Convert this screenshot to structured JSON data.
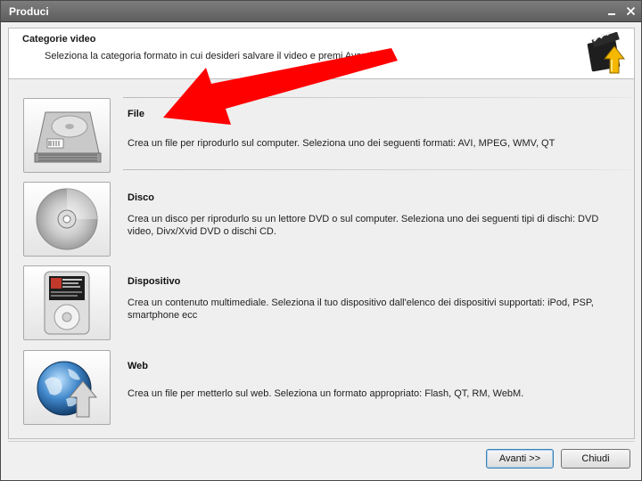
{
  "window": {
    "title": "Produci"
  },
  "header": {
    "title": "Categorie video",
    "subtitle": "Seleziona la categoria formato in cui desideri salvare il video e premi Avanti",
    "icon": "film-upload-icon"
  },
  "categories": [
    {
      "title": "File",
      "description": "Crea un file per riprodurlo sul computer. Seleziona uno dei seguenti formati: AVI, MPEG, WMV, QT",
      "icon": "hard-drive-icon",
      "selected": true
    },
    {
      "title": "Disco",
      "description": "Crea un disco per riprodurlo su un lettore DVD o sul computer. Seleziona uno dei seguenti tipi di dischi: DVD video, Divx/Xvid DVD o dischi CD.",
      "icon": "disc-icon",
      "selected": false
    },
    {
      "title": "Dispositivo",
      "description": "Crea un contenuto multimediale. Seleziona il tuo dispositivo dall'elenco dei dispositivi supportati: iPod, PSP, smartphone ecc",
      "icon": "media-player-icon",
      "selected": false
    },
    {
      "title": "Web",
      "description": "Crea un file per metterlo sul web. Seleziona un formato appropriato:  Flash, QT, RM, WebM.",
      "icon": "globe-icon",
      "selected": false
    }
  ],
  "buttons": {
    "next": "Avanti >>",
    "close": "Chiudi"
  },
  "colors": {
    "annotation_arrow": "#ff0000",
    "titlebar": "#6a6a6a",
    "default_button_border": "#3c7fb1"
  }
}
